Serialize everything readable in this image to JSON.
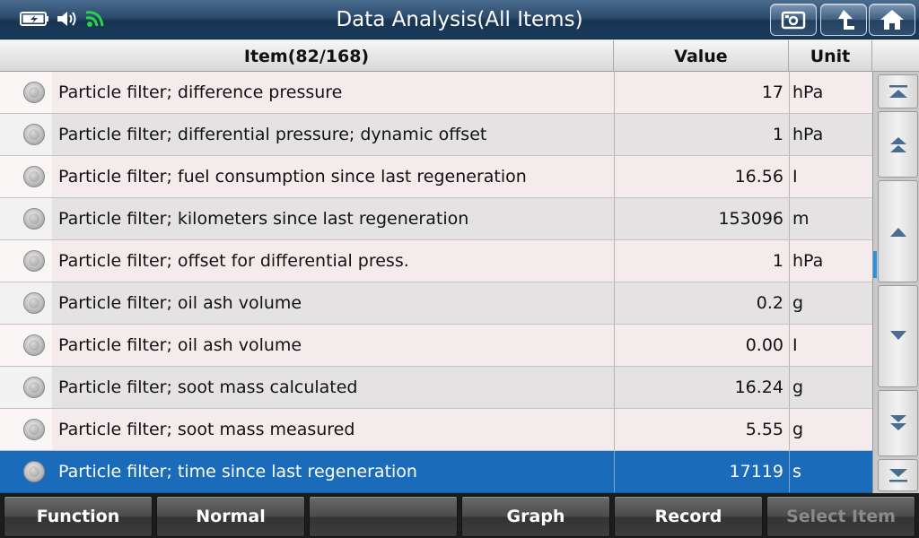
{
  "titlebar": {
    "title": "Data Analysis(All Items)",
    "status_icons": [
      "battery-charging-icon",
      "speaker-icon",
      "wifi-icon"
    ],
    "buttons": [
      {
        "name": "screenshot-icon"
      },
      {
        "name": "back-arrow-icon"
      },
      {
        "name": "home-icon"
      }
    ]
  },
  "table": {
    "headers": {
      "item": "Item(82/168)",
      "value": "Value",
      "unit": "Unit"
    },
    "rows": [
      {
        "name": "Particle filter; difference pressure",
        "value": "17",
        "unit": "hPa"
      },
      {
        "name": "Particle filter; differential pressure; dynamic offset",
        "value": "1",
        "unit": "hPa"
      },
      {
        "name": "Particle filter; fuel consumption since last regeneration",
        "value": "16.56",
        "unit": "I"
      },
      {
        "name": "Particle filter; kilometers since last regeneration",
        "value": "153096",
        "unit": "m"
      },
      {
        "name": "Particle filter; offset for differential press.",
        "value": "1",
        "unit": "hPa"
      },
      {
        "name": "Particle filter; oil ash volume",
        "value": "0.2",
        "unit": "g"
      },
      {
        "name": "Particle filter; oil ash volume",
        "value": "0.00",
        "unit": "I"
      },
      {
        "name": "Particle filter; soot mass calculated",
        "value": "16.24",
        "unit": "g"
      },
      {
        "name": "Particle filter; soot mass measured",
        "value": "5.55",
        "unit": "g"
      },
      {
        "name": "Particle filter; time since last regeneration",
        "value": "17119",
        "unit": "s",
        "selected": true
      }
    ]
  },
  "scroll": {
    "buttons": [
      "scroll-top-icon",
      "page-up-icon",
      "line-up-icon",
      "line-down-icon",
      "page-down-icon",
      "scroll-bottom-icon"
    ]
  },
  "toolbar": {
    "function": "Function",
    "normal": "Normal",
    "empty": "",
    "graph": "Graph",
    "record": "Record",
    "select_item": "Select Item"
  },
  "colors": {
    "selected_row": "#1a6cba",
    "titlebar": "#1b3a5a",
    "wifi": "#2bd14a"
  }
}
